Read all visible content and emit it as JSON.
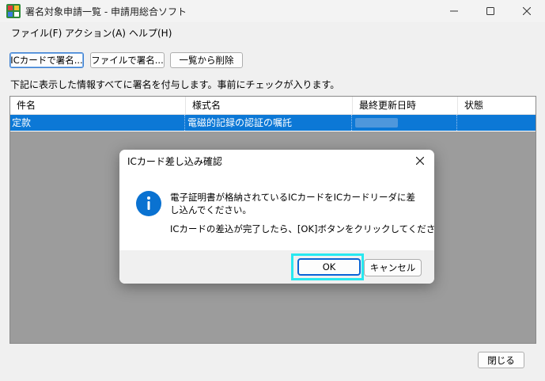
{
  "window": {
    "title": "署名対象申請一覧 - 申請用総合ソフト"
  },
  "menu": {
    "file": "ファイル(F)",
    "action": "アクション(A)",
    "help": "ヘルプ(H)"
  },
  "toolbar": {
    "sign_ic_card": "ICカードで署名...",
    "sign_file": "ファイルで署名...",
    "remove_from_list": "一覧から削除"
  },
  "description": "下記に表示した情報すべてに署名を付与します。事前にチェックが入ります。",
  "table": {
    "columns": [
      "件名",
      "様式名",
      "最終更新日時",
      "状態"
    ],
    "rows": [
      {
        "name": "定款",
        "format": "電磁的記録の認証の嘱託",
        "updated": "",
        "status": ""
      }
    ]
  },
  "dialog": {
    "title": "ICカード差し込み確認",
    "message_line1": "電子証明書が格納されているICカードをICカードリーダに差し込んでください。",
    "message_line2": "ICカードの差込が完了したら、[OK]ボタンをクリックしてください。",
    "ok": "OK",
    "cancel": "キャンセル"
  },
  "footer": {
    "close": "閉じる"
  },
  "colors": {
    "selection": "#0c78d6",
    "ok_highlight": "#28e8f0",
    "info_icon": "#0a72d1"
  }
}
